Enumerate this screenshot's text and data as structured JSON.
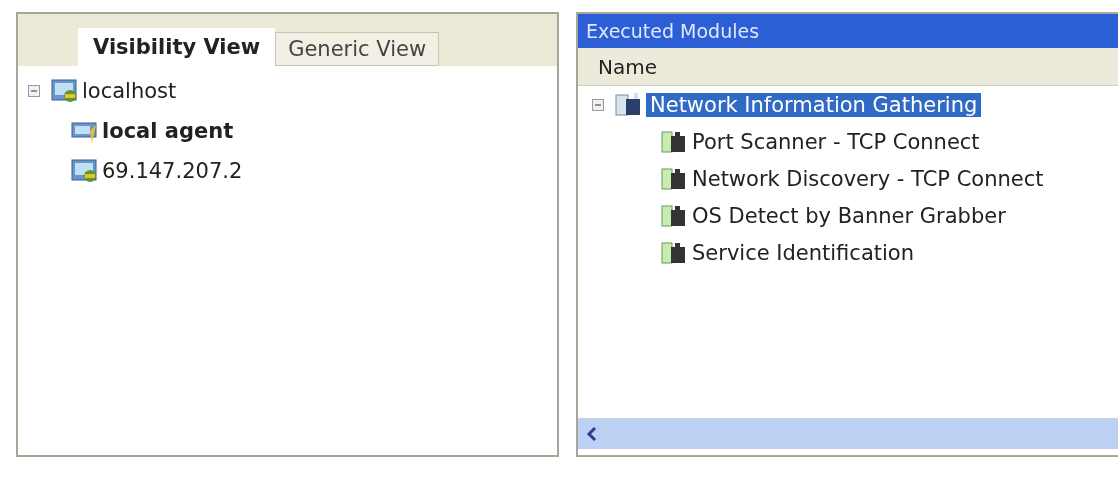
{
  "tabs": [
    {
      "label": "Visibility View",
      "selected": true
    },
    {
      "label": "Generic View",
      "selected": false
    }
  ],
  "tree": [
    {
      "label": "localhost",
      "kind": "host",
      "expanded": true,
      "children": [
        {
          "label": "local agent",
          "kind": "agent"
        },
        {
          "label": "69.147.207.2",
          "kind": "host"
        }
      ]
    }
  ],
  "modules": {
    "title": "Executed Modules",
    "columns": [
      "Name"
    ],
    "items": [
      {
        "label": "Network Information Gathering",
        "kind": "folder",
        "selected": true,
        "expanded": true,
        "children": [
          {
            "label": "Port Scanner - TCP Connect",
            "kind": "module",
            "selected": false
          },
          {
            "label": "Network Discovery - TCP Connect",
            "kind": "module",
            "selected": false
          },
          {
            "label": "OS Detect by Banner Grabber",
            "kind": "module",
            "selected": false
          },
          {
            "label": "Service Identification",
            "kind": "module",
            "selected": false
          }
        ]
      }
    ]
  }
}
